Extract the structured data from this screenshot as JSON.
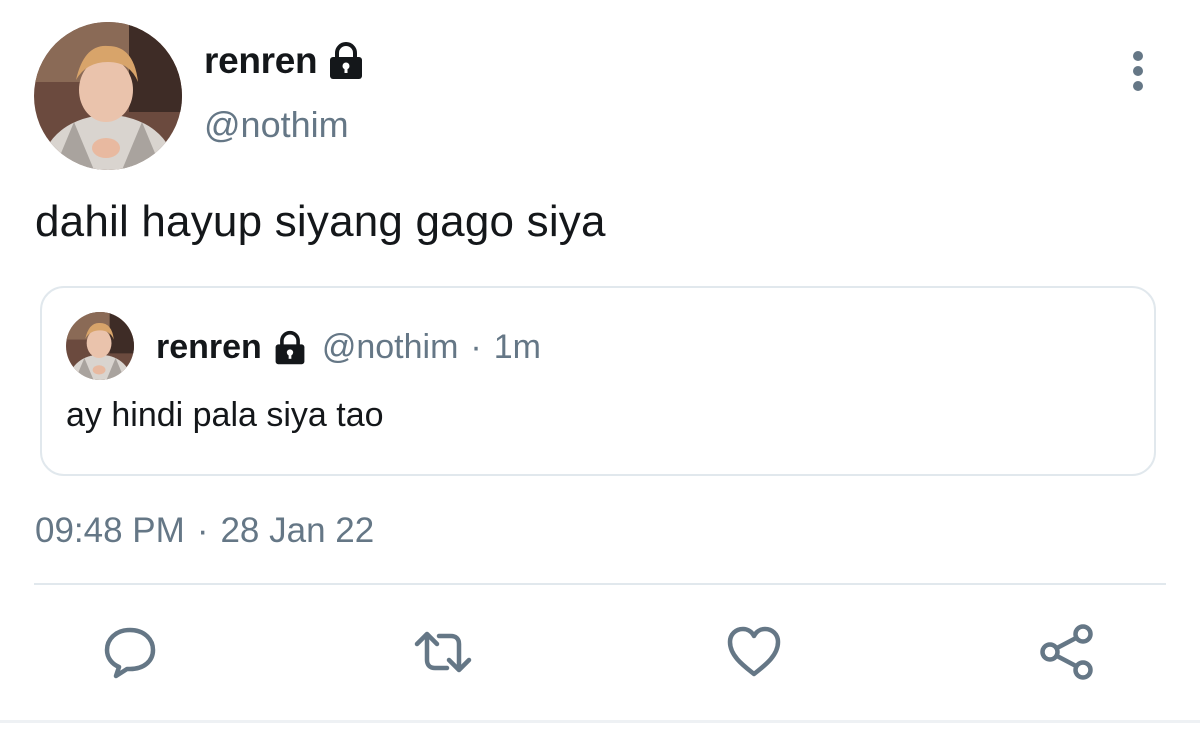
{
  "tweet": {
    "author": {
      "display_name": "renren",
      "handle": "@nothim",
      "protected_icon": "lock-icon"
    },
    "text": "dahil hayup siyang gago siya",
    "more_icon": "more-vertical-icon",
    "timestamp": {
      "time": "09:48 PM",
      "separator": "·",
      "date": "28 Jan 22"
    },
    "quoted": {
      "display_name": "renren",
      "handle": "@nothim",
      "separator": "·",
      "time": "1m",
      "text": "ay hindi pala siya tao",
      "protected_icon": "lock-icon"
    },
    "actions": [
      {
        "name": "reply",
        "icon": "reply-icon"
      },
      {
        "name": "retweet",
        "icon": "retweet-icon"
      },
      {
        "name": "like",
        "icon": "heart-icon"
      },
      {
        "name": "share",
        "icon": "share-icon"
      }
    ]
  },
  "colors": {
    "text_primary": "#14171a",
    "text_secondary": "#657786",
    "border": "#e1e8ed",
    "icon": "#657786"
  }
}
